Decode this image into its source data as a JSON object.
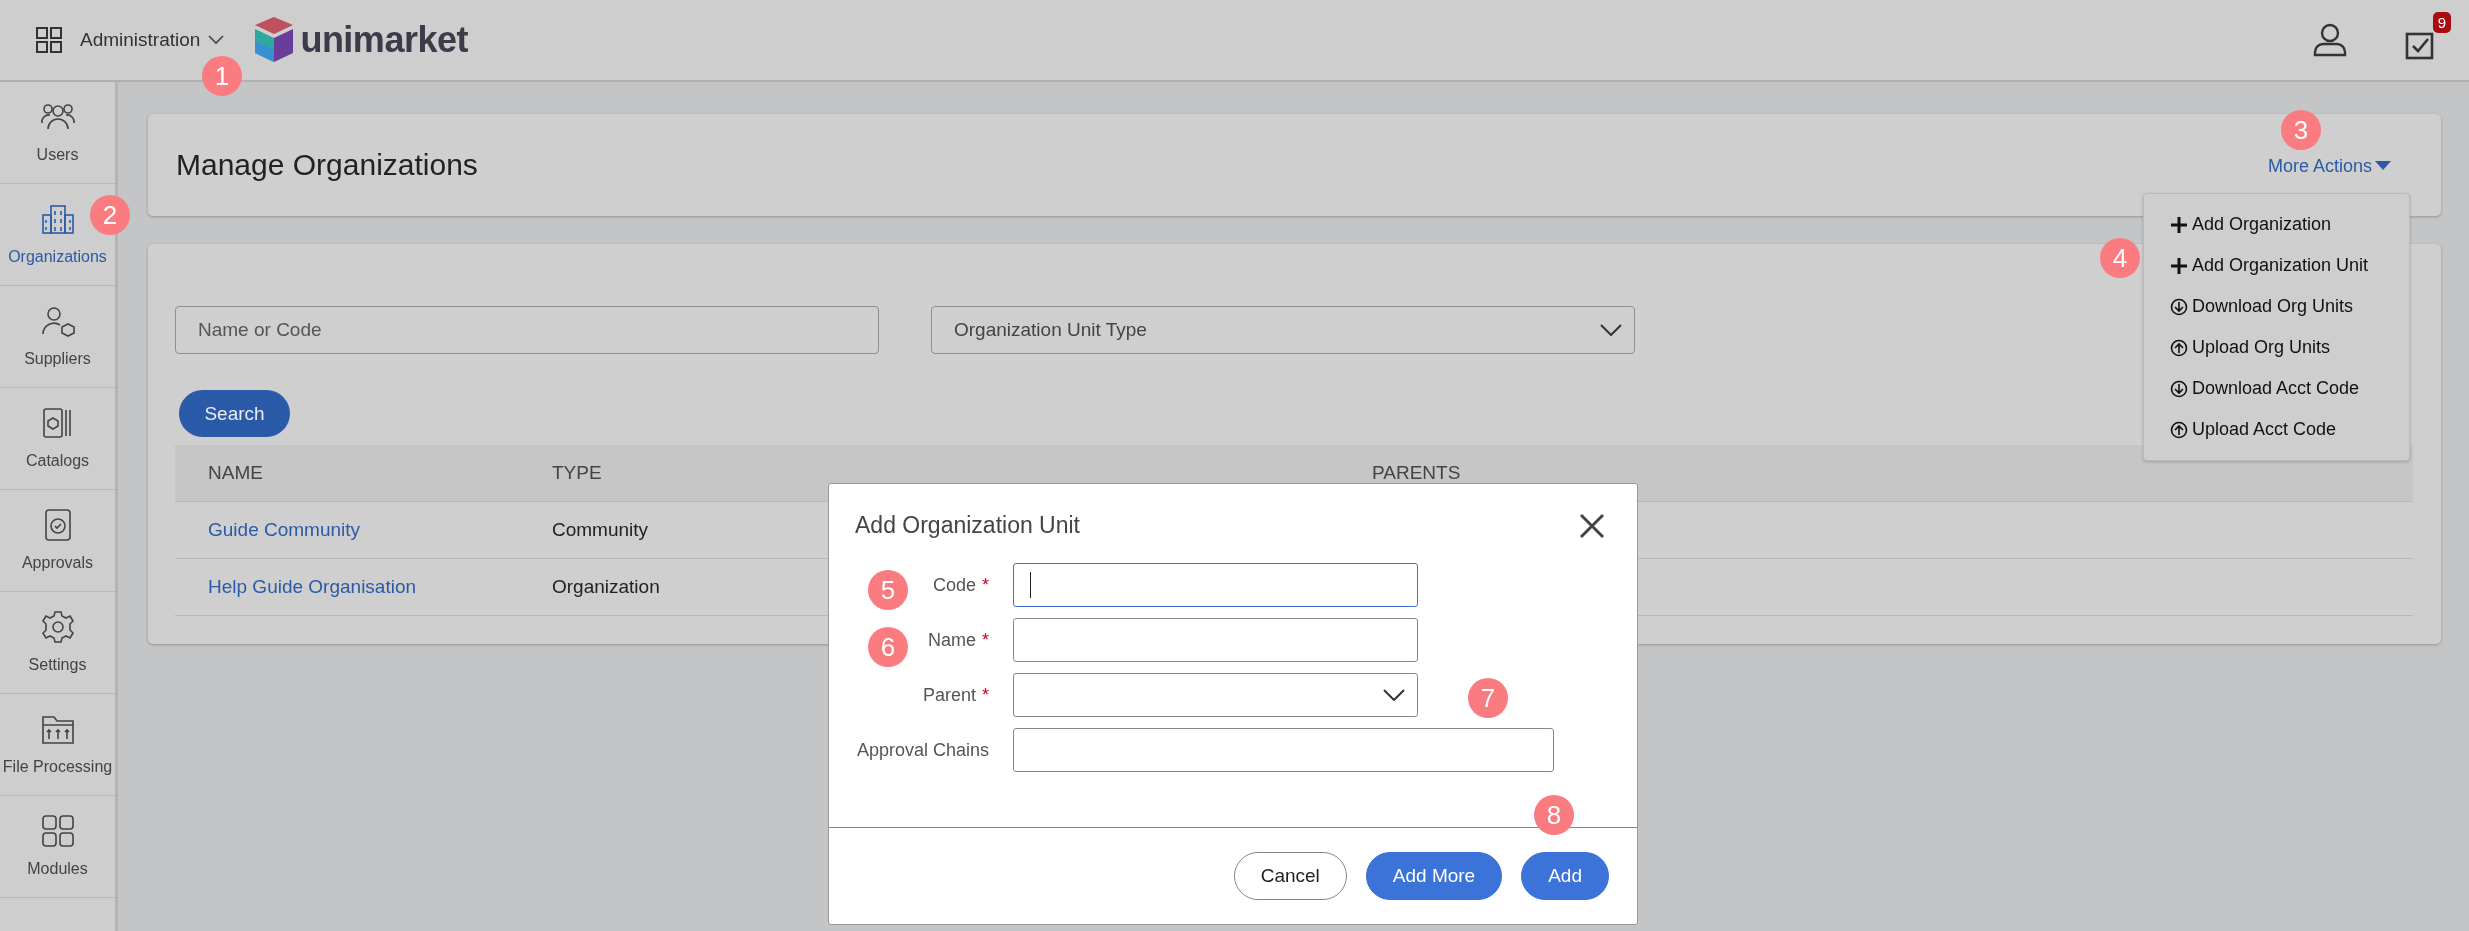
{
  "topbar": {
    "app_menu": "Administration",
    "logo": "unimarket",
    "notifications": "9"
  },
  "sidebar": {
    "items": [
      {
        "label": "Users",
        "selected": false
      },
      {
        "label": "Organizations",
        "selected": true
      },
      {
        "label": "Suppliers",
        "selected": false
      },
      {
        "label": "Catalogs",
        "selected": false
      },
      {
        "label": "Approvals",
        "selected": false
      },
      {
        "label": "Settings",
        "selected": false
      },
      {
        "label": "File Processing",
        "selected": false
      },
      {
        "label": "Modules",
        "selected": false
      }
    ]
  },
  "page": {
    "title": "Manage Organizations",
    "more_actions": "More Actions"
  },
  "actions_menu": [
    {
      "label": "Add Organization",
      "kind": "add"
    },
    {
      "label": "Add Organization Unit",
      "kind": "add"
    },
    {
      "label": "Download Org Units",
      "kind": "download"
    },
    {
      "label": "Upload Org Units",
      "kind": "upload"
    },
    {
      "label": "Download Acct Code",
      "kind": "download"
    },
    {
      "label": "Upload Acct Code",
      "kind": "upload"
    }
  ],
  "filters": {
    "search": {
      "placeholder": "Name or Code"
    },
    "type": {
      "placeholder": "Organization Unit Type"
    },
    "button": "Search"
  },
  "table": {
    "columns": [
      "NAME",
      "TYPE",
      "PARENTS"
    ],
    "rows": [
      {
        "name": "Guide Community",
        "type": "Community"
      },
      {
        "name": "Help Guide Organisation",
        "type": "Organization"
      }
    ]
  },
  "dialog": {
    "title": "Add Organization Unit",
    "fields": [
      {
        "label": "Code",
        "required_mark": "*",
        "kind": "text",
        "focused": true
      },
      {
        "label": "Name",
        "required_mark": "*",
        "kind": "text",
        "focused": false
      },
      {
        "label": "Parent",
        "required_mark": "*",
        "kind": "select",
        "focused": false
      },
      {
        "label": "Approval Chains",
        "kind": "wide",
        "focused": false
      }
    ],
    "buttons": [
      {
        "label": "Cancel",
        "kind": "secondary"
      },
      {
        "label": "Add More",
        "kind": "primary"
      },
      {
        "label": "Add",
        "kind": "primary"
      }
    ]
  },
  "annotations": [
    "1",
    "2",
    "3",
    "4",
    "5",
    "6",
    "7",
    "8"
  ]
}
